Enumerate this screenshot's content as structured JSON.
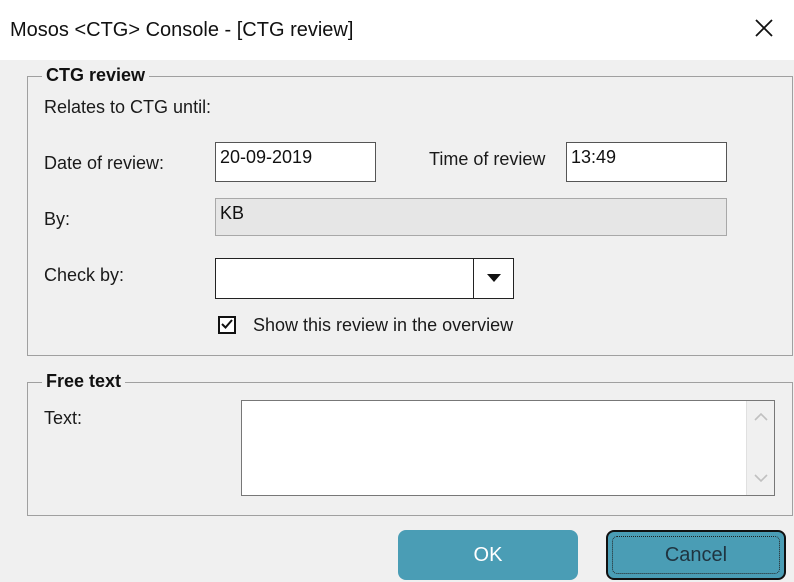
{
  "window": {
    "title": "Mosos <CTG> Console - [CTG review]",
    "close_icon": "close-icon"
  },
  "ctg_review": {
    "legend": "CTG review",
    "relates_label": "Relates to CTG until:",
    "date_label": "Date of review:",
    "date_value": "20-09-2019",
    "time_label": "Time of review",
    "time_value": "13:49",
    "by_label": "By:",
    "by_value": "KB",
    "check_by_label": "Check by:",
    "check_by_value": "",
    "show_overview_label": "Show this review in the overview",
    "show_overview_checked": true
  },
  "free_text": {
    "legend": "Free text",
    "text_label": "Text:",
    "text_value": ""
  },
  "buttons": {
    "ok_label": "OK",
    "cancel_label": "Cancel"
  },
  "colors": {
    "button_bg": "#4a9db5",
    "dialog_bg": "#f0f0f0",
    "readonly_bg": "#e6e6e6"
  }
}
